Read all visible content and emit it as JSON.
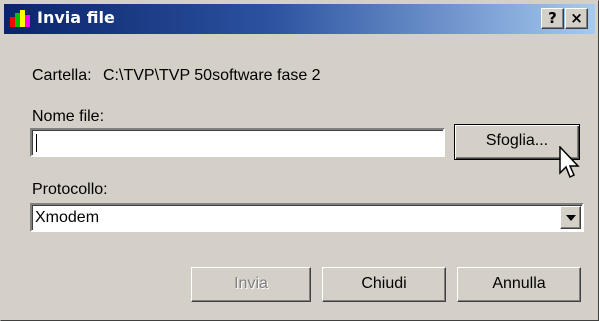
{
  "window": {
    "title": "Invia file",
    "help_button": "?",
    "close_button": "×",
    "icon": "app-icon"
  },
  "form": {
    "folder_label": "Cartella:",
    "folder_path": "C:\\TVP\\TVP 50software fase 2",
    "filename_label": "Nome file:",
    "filename_value": "",
    "protocol_label": "Protocollo:",
    "protocol_selected": "Xmodem"
  },
  "buttons": {
    "browse": "Sfoglia...",
    "send": "Invia",
    "close": "Chiudi",
    "cancel": "Annulla"
  },
  "colors": {
    "titlebar_start": "#0a246a",
    "titlebar_end": "#a6caf0",
    "face": "#d4d0c8",
    "disabled_text": "#808080"
  }
}
